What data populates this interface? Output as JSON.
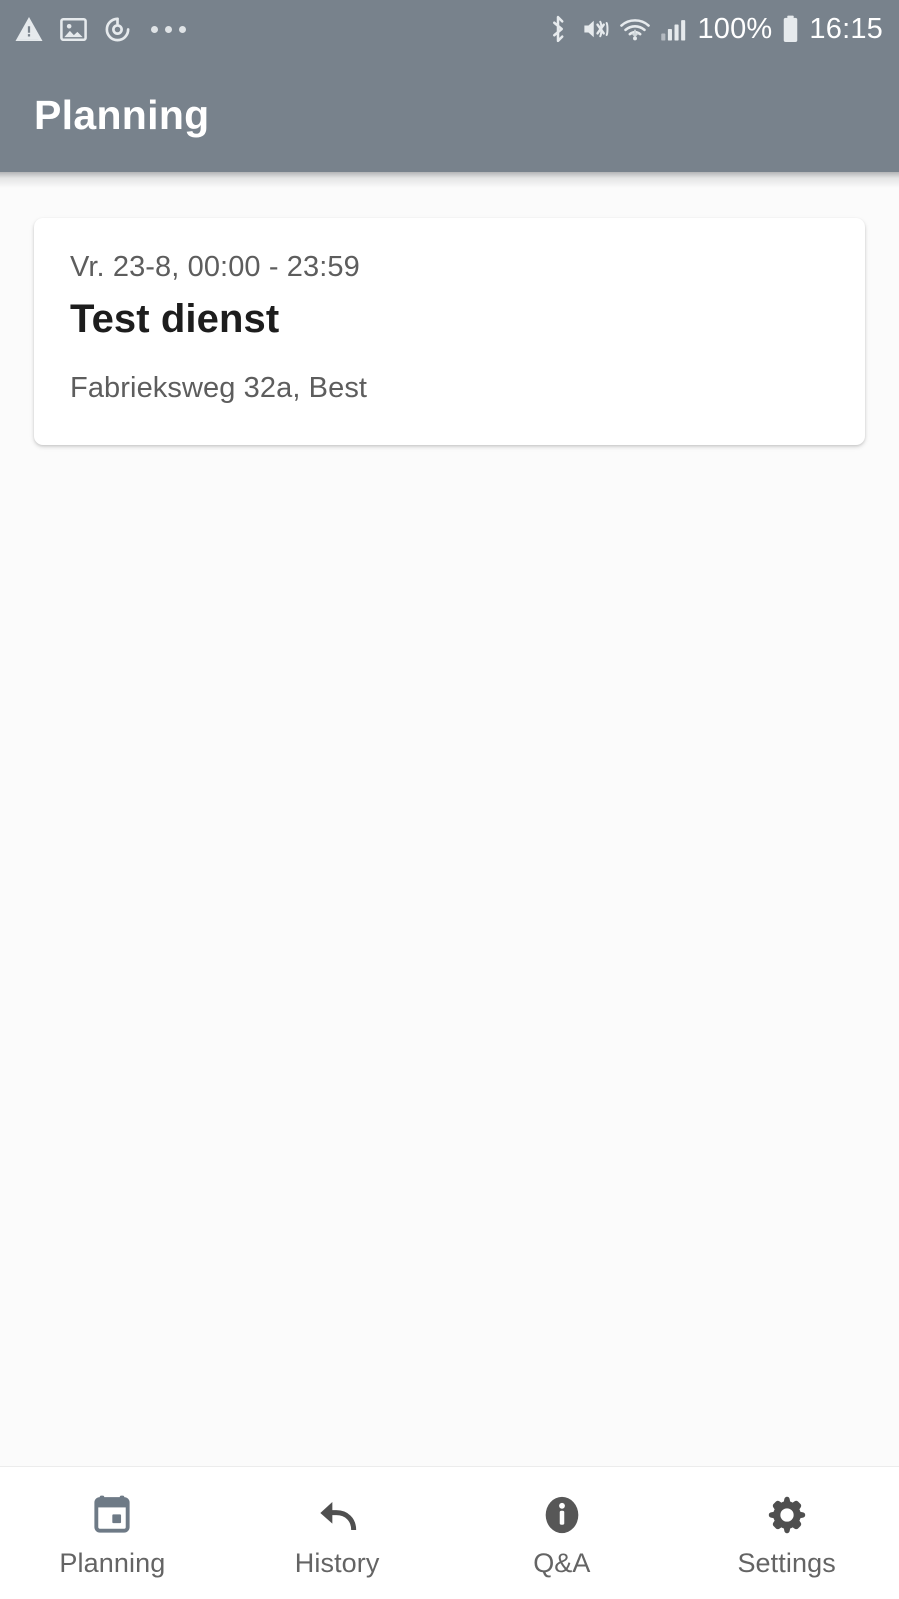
{
  "status_bar": {
    "left_icons": [
      "warning-triangle-icon",
      "image-icon",
      "timer-icon",
      "more-notifications-dots"
    ],
    "right_icons": [
      "bluetooth-icon",
      "vibrate-mute-icon",
      "wifi-download-icon",
      "cellular-signal-icon"
    ],
    "battery_percent": "100%",
    "time": "16:15",
    "background_color": "#78828c"
  },
  "app_bar": {
    "title": "Planning",
    "background_color": "#78828c",
    "title_color": "#ffffff"
  },
  "content": {
    "background_color": "#fbfbfb",
    "shifts": [
      {
        "time": "Vr. 23-8, 00:00 - 23:59",
        "title": "Test dienst",
        "address": "Fabrieksweg 32a, Best"
      }
    ]
  },
  "bottom_nav": {
    "items": [
      {
        "label": "Planning",
        "icon": "calendar-icon",
        "active": true
      },
      {
        "label": "History",
        "icon": "undo-arrow-icon",
        "active": false
      },
      {
        "label": "Q&A",
        "icon": "info-circle-icon",
        "active": false
      },
      {
        "label": "Settings",
        "icon": "gear-icon",
        "active": false
      }
    ],
    "label_color": "#646464",
    "background_color": "#ffffff"
  }
}
